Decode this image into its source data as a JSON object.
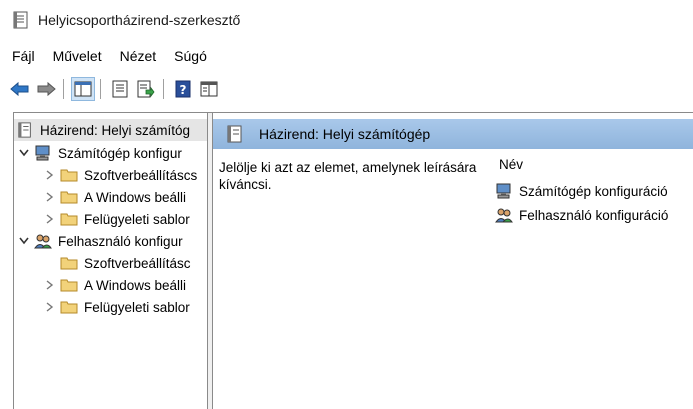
{
  "window": {
    "title": "Helyicsoportházirend-szerkesztő"
  },
  "menu": [
    "Fájl",
    "Művelet",
    "Nézet",
    "Súgó"
  ],
  "toolbar": {
    "buttons": [
      "back-arrow-icon",
      "forward-arrow-icon",
      "show-hide-tree-icon",
      "properties-icon",
      "export-list-icon",
      "help-icon",
      "extended-view-icon"
    ]
  },
  "tree": {
    "root": "Házirend: Helyi számítóg",
    "computer": {
      "label": "Számítógép konfigur",
      "children": [
        "Szoftverbeállításcs",
        "A Windows beálli",
        "Felügyeleti sablor"
      ]
    },
    "user": {
      "label": "Felhasználó konfigur",
      "children": [
        "Szoftverbeállításc",
        "A Windows beálli",
        "Felügyeleti sablor"
      ]
    }
  },
  "details": {
    "header": "Házirend: Helyi számítógép",
    "description": "Jelölje ki azt az elemet, amelynek leírására kíváncsi.",
    "column": "Név",
    "items": [
      "Számítógép konfiguráció",
      "Felhasználó konfiguráció"
    ]
  },
  "colors": {
    "header_gradient_top": "#a9c8ea",
    "header_gradient_bottom": "#8fb4dc",
    "selected_root": "#e5e5e5",
    "folder": "#f2d27a"
  }
}
